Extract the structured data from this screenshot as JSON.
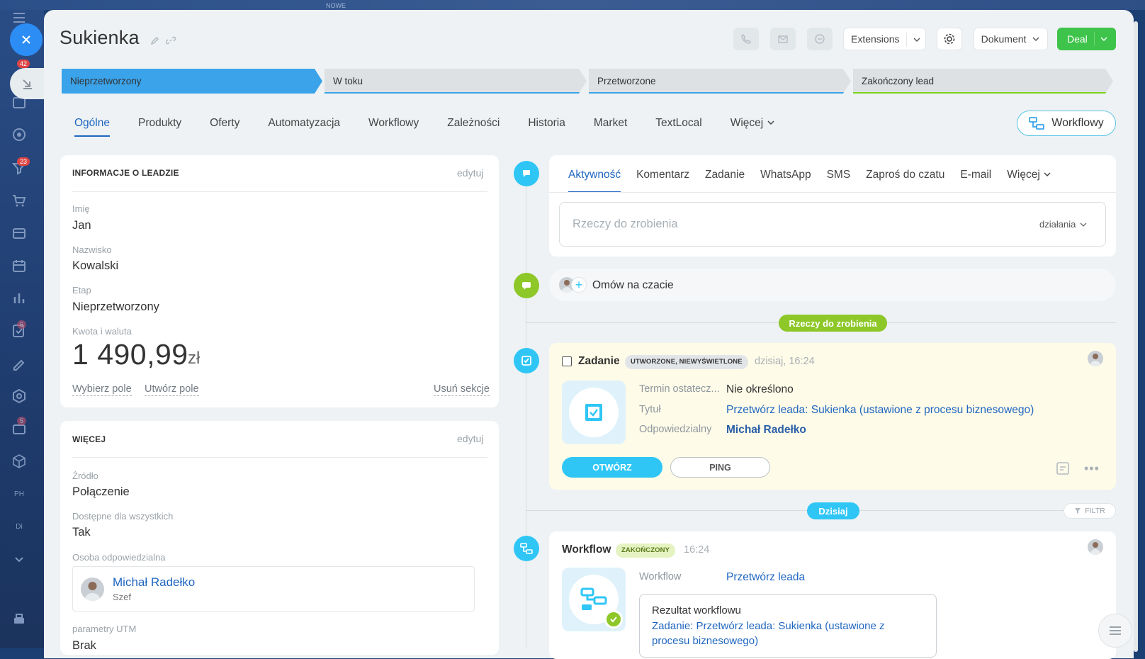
{
  "sidebar": {
    "badges": [
      "42",
      "23",
      "5",
      "5"
    ],
    "labels": [
      "PH",
      "Di"
    ]
  },
  "top_label": "NOWE",
  "header": {
    "title": "Sukienka",
    "extensions_label": "Extensions",
    "document_label": "Dokument",
    "deal_label": "Deal"
  },
  "stages": [
    {
      "label": "Nieprzetworzony",
      "color": "#3aa3ea"
    },
    {
      "label": "W toku",
      "color": "#3aa3ea"
    },
    {
      "label": "Przetworzone",
      "color": "#3aa3ea"
    },
    {
      "label": "Zakończony lead",
      "color": "#7bd51c"
    }
  ],
  "tabs": [
    "Ogólne",
    "Produkty",
    "Oferty",
    "Automatyzacja",
    "Workflowy",
    "Zależności",
    "Historia",
    "Market",
    "TextLocal",
    "Więcej"
  ],
  "workflow_button": "Workflowy",
  "lead_info": {
    "title": "INFORMACJE O LEADZIE",
    "edit": "edytuj",
    "fields": [
      {
        "label": "Imię",
        "value": "Jan"
      },
      {
        "label": "Nazwisko",
        "value": "Kowalski"
      },
      {
        "label": "Etap",
        "value": "Nieprzetworzony"
      }
    ],
    "amount_label": "Kwota i waluta",
    "amount": "1 490,99",
    "currency": "zł",
    "select_field": "Wybierz pole",
    "create_field": "Utwórz pole",
    "delete_section": "Usuń sekcje"
  },
  "more_info": {
    "title": "WIĘCEJ",
    "edit": "edytuj",
    "source_label": "Źródło",
    "source_value": "Połączenie",
    "available_label": "Dostępne dla wszystkich",
    "available_value": "Tak",
    "responsible_label": "Osoba odpowiedzialna",
    "responsible_name": "Michał Radełko",
    "responsible_role": "Szef",
    "utm_label": "parametry UTM",
    "utm_value": "Brak"
  },
  "activity": {
    "tabs": [
      "Aktywność",
      "Komentarz",
      "Zadanie",
      "WhatsApp",
      "SMS",
      "Zaproś do czatu",
      "E-mail",
      "Więcej"
    ],
    "todo_placeholder": "Rzeczy do zrobienia",
    "actions_label": "działania",
    "chat_label": "Omów na czacie",
    "todo_pill": "Rzeczy do zrobienia",
    "today_pill": "Dzisiaj",
    "filter_label": "FILTR"
  },
  "task": {
    "title": "Zadanie",
    "badge": "UTWORZONE, NIEWYŚWIETLONE",
    "time": "dzisiaj, 16:24",
    "deadline_label": "Termin ostatecz...",
    "deadline_value": "Nie określono",
    "title_label": "Tytuł",
    "title_value": "Przetwórz leada: Sukienka (ustawione z procesu biznesowego)",
    "responsible_label": "Odpowiedzialny",
    "responsible_value": "Michał Radełko",
    "open_btn": "OTWÓRZ",
    "ping_btn": "PING"
  },
  "workflow_item": {
    "title": "Workflow",
    "badge": "ZAKOŃCZONY",
    "time": "16:24",
    "wf_label": "Workflow",
    "wf_value": "Przetwórz leada",
    "result_title": "Rezultat workflowu",
    "result_line1": "Zadanie: Przetwórz leada: Sukienka  (ustawione z",
    "result_line2": "procesu biznesowego)"
  }
}
